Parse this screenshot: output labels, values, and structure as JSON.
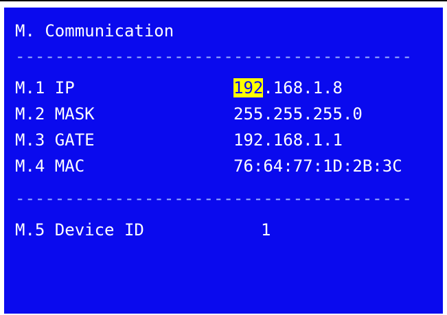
{
  "screen": {
    "title": "M. Communication",
    "separator": "----------------------------------------",
    "ip": {
      "label": "M.1 IP",
      "value_highlight": "192",
      "value_rest": ".168.1.8"
    },
    "mask": {
      "label": "M.2 MASK",
      "value": "255.255.255.0"
    },
    "gate": {
      "label": "M.3 GATE",
      "value": "192.168.1.1"
    },
    "mac": {
      "label": "M.4 MAC",
      "value": "76:64:77:1D:2B:3C"
    },
    "device_id": {
      "label": "M.5 Device ID",
      "value": "1"
    }
  },
  "colors": {
    "background": "#0a0aee",
    "text": "#ffffff",
    "highlight": "#ffff00"
  }
}
